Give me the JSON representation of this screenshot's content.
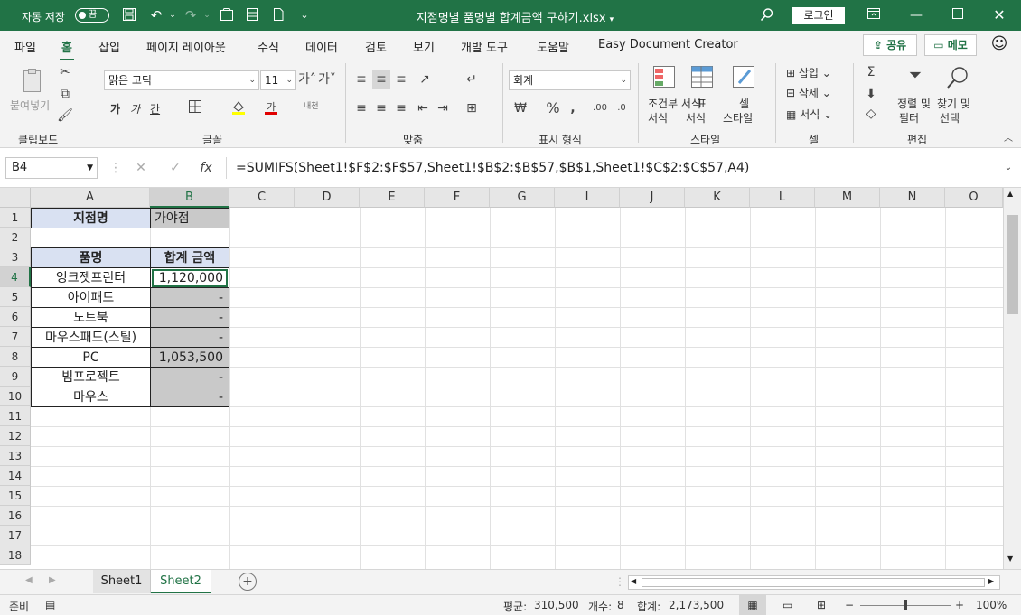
{
  "titlebar": {
    "autosave_label": "자동 저장",
    "autosave_state": "끔",
    "document_title": "지점명별 품명별 합계금액 구하기.xlsx",
    "login_label": "로그인"
  },
  "tabs": [
    "파일",
    "홈",
    "삽입",
    "페이지 레이아웃",
    "수식",
    "데이터",
    "검토",
    "보기",
    "개발 도구",
    "도움말",
    "Easy Document Creator"
  ],
  "active_tab": "홈",
  "share_label": "공유",
  "memo_label": "메모",
  "ribbon": {
    "clipboard": {
      "paste_label": "붙여넣기",
      "group_label": "클립보드"
    },
    "font": {
      "font_name": "맑은 고딕",
      "font_size": "11",
      "group_label": "글꼴",
      "bold": "가",
      "italic": "가",
      "underline": "간",
      "phonetic": "내천"
    },
    "alignment": {
      "group_label": "맞춤"
    },
    "number": {
      "format": "회계",
      "group_label": "표시 형식"
    },
    "styles": {
      "conditional": "조건부 서식",
      "conditional_line2": "서식",
      "table_label": "표",
      "table_line2": "서식",
      "cell_style": "셀",
      "cell_style_line2": "스타일",
      "group_label": "스타일"
    },
    "cells": {
      "insert": "삽입",
      "delete": "삭제",
      "format": "서식",
      "group_label": "셀"
    },
    "editing": {
      "sort_filter": "정렬 및",
      "sort_filter_line2": "필터",
      "find_select": "찾기 및",
      "find_select_line2": "선택",
      "group_label": "편집"
    }
  },
  "formula_bar": {
    "name_box": "B4",
    "formula": "=SUMIFS(Sheet1!$F$2:$F$57,Sheet1!$B$2:$B$57,$B$1,Sheet1!$C$2:$C$57,A4)"
  },
  "columns": [
    "A",
    "B",
    "C",
    "D",
    "E",
    "F",
    "G",
    "I",
    "J",
    "K",
    "L",
    "M",
    "N",
    "O"
  ],
  "rows": [
    "1",
    "2",
    "3",
    "4",
    "5",
    "6",
    "7",
    "8",
    "9",
    "10",
    "11",
    "12",
    "13",
    "14",
    "15",
    "16",
    "17",
    "18"
  ],
  "cells": {
    "A1": "지점명",
    "B1": "가야점",
    "A3": "품명",
    "B3": "합계 금액",
    "A4": "잉크젯프린터",
    "B4": "1,120,000",
    "A5": "아이패드",
    "B5": "-",
    "A6": "노트북",
    "B6": "-",
    "A7": "마우스패드(스틸)",
    "B7": "-",
    "A8": "PC",
    "B8": "1,053,500",
    "A9": "빔프로젝트",
    "B9": "-",
    "A10": "마우스",
    "B10": "-"
  },
  "sheets": [
    "Sheet1",
    "Sheet2"
  ],
  "active_sheet": "Sheet2",
  "status": {
    "mode": "준비",
    "average_label": "평균:",
    "average": "310,500",
    "count_label": "개수:",
    "count": "8",
    "sum_label": "합계:",
    "sum": "2,173,500",
    "zoom": "100%"
  },
  "colors": {
    "accent": "#217346",
    "header_fill": "#d9e1f2",
    "gray_fill": "#c9c9c9"
  }
}
